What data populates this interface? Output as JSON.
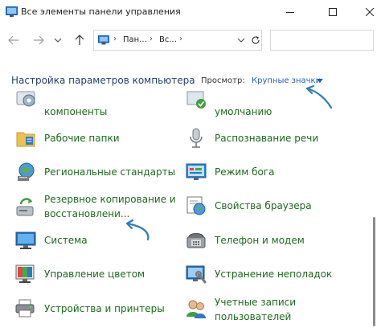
{
  "window": {
    "title": "Все элементы панели управления"
  },
  "address": {
    "crumbs": [
      "Пан...",
      "Вс..."
    ],
    "search_placeholder": ""
  },
  "header": {
    "title": "Настройка параметров компьютера",
    "view_label": "Просмотр:",
    "view_value": "Крупные значки"
  },
  "items_left": [
    {
      "label": "компоненты",
      "icon": "programs-icon"
    },
    {
      "label": "Рабочие папки",
      "icon": "work-folders-icon"
    },
    {
      "label": "Региональные стандарты",
      "icon": "region-icon"
    },
    {
      "label_line1": "Резервное копирование и",
      "label_line2": "восстановлени...",
      "icon": "backup-restore-icon"
    },
    {
      "label": "Система",
      "icon": "system-icon"
    },
    {
      "label": "Управление цветом",
      "icon": "color-management-icon"
    },
    {
      "label": "Устройства и принтеры",
      "icon": "devices-printers-icon"
    }
  ],
  "items_right": [
    {
      "label": "умолчанию",
      "icon": "default-programs-icon"
    },
    {
      "label": "Распознавание речи",
      "icon": "speech-recognition-icon"
    },
    {
      "label": "Режим бога",
      "icon": "god-mode-icon"
    },
    {
      "label": "Свойства браузера",
      "icon": "internet-options-icon"
    },
    {
      "label": "Телефон и модем",
      "icon": "phone-modem-icon"
    },
    {
      "label": "Устранение неполадок",
      "icon": "troubleshooting-icon"
    },
    {
      "label_line1": "Учетные записи",
      "label_line2": "пользователей",
      "icon": "user-accounts-icon"
    }
  ],
  "colors": {
    "item_text": "#1a6b1a",
    "header_text": "#1e3f6e",
    "link": "#1f5fbf",
    "annotation_arrow": "#2b7fb8"
  }
}
